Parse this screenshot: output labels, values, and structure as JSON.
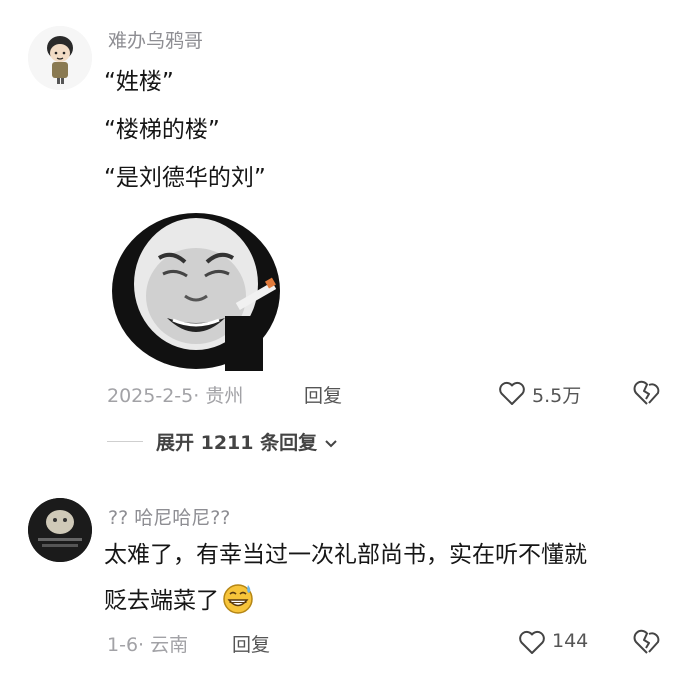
{
  "comment1": {
    "username": "难办乌鸦哥",
    "lines": [
      "“姓楼”",
      "“楼梯的楼”",
      "“是刘德华的刘”"
    ],
    "meta": "2025-2-5· 贵州",
    "reply_label": "回复",
    "likes": "5.5万"
  },
  "replies_toggle": "展开 1211 条回复",
  "comment2": {
    "username": "?? 哈尼哈尼??",
    "text_line1": "太难了，有幸当过一次礼部尚书，实在听不懂就",
    "text_line2": "贬去端菜了",
    "meta": "1-6· 云南",
    "reply_label": "回复",
    "likes": "144"
  },
  "icons": [
    "avatar-cartoon-icon",
    "panda-meme-sticker",
    "heart-icon",
    "broken-heart-icon",
    "chevron-down-icon",
    "sweat-grin-emoji-icon"
  ],
  "colors": {
    "text": "#161616",
    "secondary": "#8e8e93",
    "meta": "#a2a2a6"
  }
}
